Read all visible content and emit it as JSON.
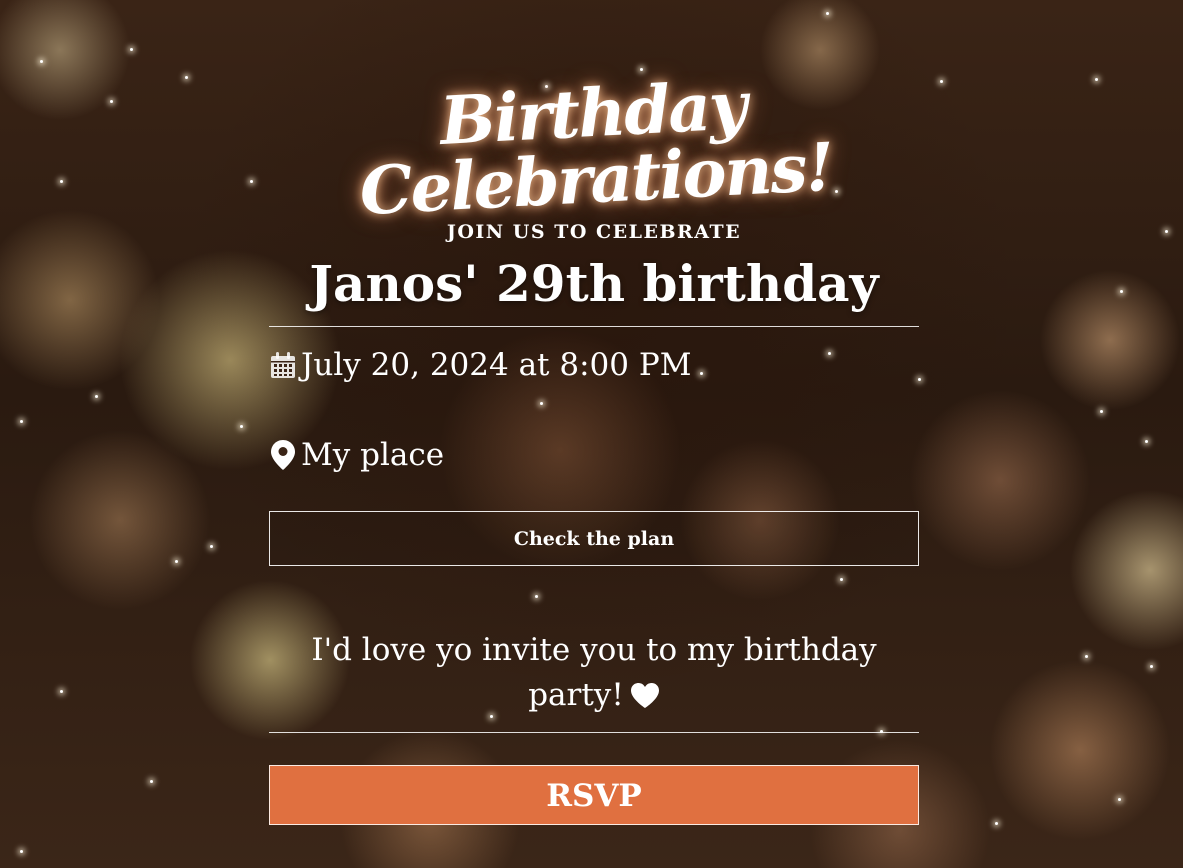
{
  "invite": {
    "script_title": "Birthday Celebrations!",
    "pretitle": "JOIN US TO CELEBRATE",
    "event_title": "Janos' 29th birthday",
    "date_text": "July 20, 2024 at 8:00 PM",
    "place_text": "My place",
    "plan_button_label": "Check the plan",
    "message": "I'd love yo invite you to my birthday party!",
    "rsvp_label": "RSVP"
  },
  "icons": {
    "date": "calendar-icon",
    "place": "map-pin-icon",
    "message": "heart-icon"
  },
  "colors": {
    "accent": "#e07040",
    "text": "#ffffff"
  }
}
